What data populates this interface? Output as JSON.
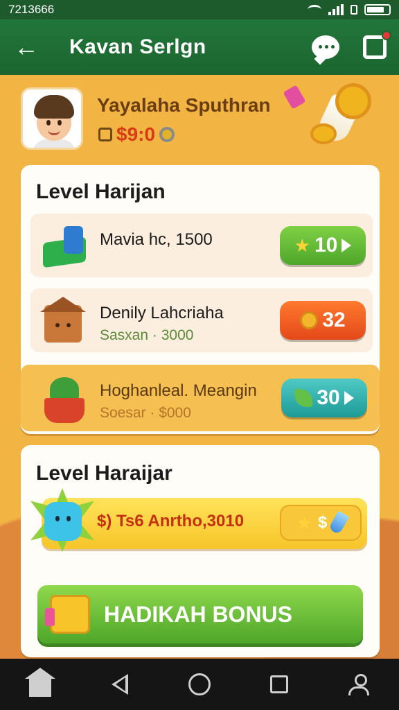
{
  "status_bar": {
    "time": "7213666",
    "icons": [
      "wifi-icon",
      "signal-icon",
      "sim-icon",
      "battery-icon"
    ]
  },
  "app_bar": {
    "title": "Kavan Serlgn",
    "icons": [
      "back-arrow-icon",
      "chat-icon",
      "share-icon"
    ]
  },
  "profile": {
    "name": "Yayalaha Sputhran",
    "balance": "$9:0"
  },
  "daily_section": {
    "title": "Level Harijan",
    "items": [
      {
        "title": "Mavia hc, 1500",
        "subtitle": "",
        "reward": "10",
        "reward_icon": "star-icon",
        "accent": "#4ea62a"
      },
      {
        "title": "Denily Lahcriaha",
        "subtitle": "Sasxan · 3000",
        "reward": "32",
        "reward_icon": "coin-icon",
        "accent": "#e4481a"
      },
      {
        "title": "Hoghanleal. Meangin",
        "subtitle": "Soesar · $000",
        "reward": "30",
        "reward_icon": "leaf-icon",
        "accent": "#1e9b98"
      }
    ]
  },
  "bonus_section": {
    "title": "Level Haraijar",
    "special_text": "$) Ts6 Anrtho,3010",
    "special_reward": "$",
    "button_label": "HADIKAH BONUS"
  },
  "nav_bar": {
    "items": [
      "home-icon",
      "back-icon",
      "home-circle-icon",
      "recents-icon",
      "profile-icon"
    ]
  },
  "colors": {
    "primary": "#1b6630",
    "background": "#f2b544",
    "reward_green": "#4ea62a",
    "reward_orange": "#e4481a",
    "reward_teal": "#1e9b98",
    "bonus_button": "#4ea62a"
  }
}
